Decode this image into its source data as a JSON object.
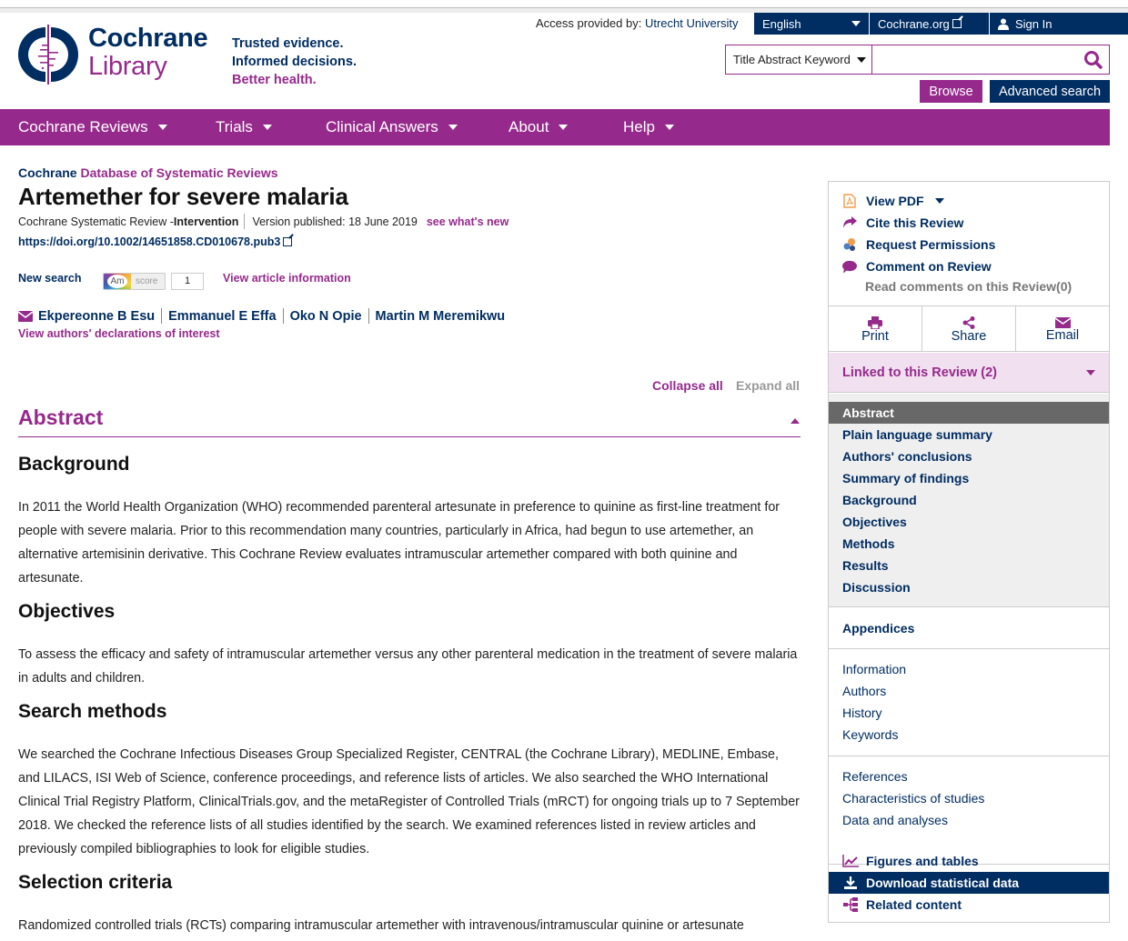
{
  "colors": {
    "brand_blue": "#002d62",
    "brand_purple": "#962a8c"
  },
  "utility": {
    "access_label": "Access provided by:",
    "access_institution": "Utrecht University",
    "language": "English",
    "cochrane_org": "Cochrane.org",
    "sign_in": "Sign In"
  },
  "logo": {
    "line1": "Cochrane",
    "line2": "Library"
  },
  "tagline": {
    "line1": "Trusted evidence.",
    "line2": "Informed decisions.",
    "line3": "Better health."
  },
  "search": {
    "scope": "Title Abstract Keyword",
    "value": "",
    "placeholder": "",
    "browse": "Browse",
    "advanced": "Advanced search"
  },
  "nav": [
    {
      "label": "Cochrane Reviews"
    },
    {
      "label": "Trials"
    },
    {
      "label": "Clinical Answers"
    },
    {
      "label": "About"
    },
    {
      "label": "Help"
    }
  ],
  "article": {
    "db_part1": "Cochrane",
    "db_part2": "Database of Systematic Reviews",
    "title": "Artemether for severe malaria",
    "review_type": "Cochrane Systematic Review - ",
    "review_kind": "Intervention",
    "version": "Version published: 18 June 2019",
    "whats_new": "see what's new",
    "doi": "https://doi.org/10.1002/14651858.CD010678.pub3",
    "new_search": "New search",
    "altmetric": {
      "am": "Am",
      "label": "score",
      "count": "1"
    },
    "view_info": "View article information",
    "authors": [
      "Ekpereonne B Esu",
      "Emmanuel E Effa",
      "Oko N Opie",
      "Martin M Meremikwu"
    ],
    "declarations": "View authors' declarations of interest",
    "collapse_all": "Collapse all",
    "expand_all": "Expand all",
    "abstract_heading": "Abstract",
    "sections": [
      {
        "heading": "Background",
        "text": "In 2011 the World Health Organization (WHO) recommended parenteral artesunate in preference to quinine as first-line treatment for people with severe malaria. Prior to this recommendation many countries, particularly in Africa, had begun to use artemether, an alternative artemisinin derivative. This Cochrane Review evaluates intramuscular artemether compared with both quinine and artesunate."
      },
      {
        "heading": "Objectives",
        "text": "To assess the efficacy and safety of intramuscular artemether versus any other parenteral medication in the treatment of severe malaria in adults and children."
      },
      {
        "heading": "Search methods",
        "text": "We searched the Cochrane Infectious Diseases Group Specialized Register, CENTRAL (the Cochrane Library), MEDLINE, Embase, and LILACS, ISI Web of Science, conference proceedings, and reference lists of articles. We also searched the WHO International Clinical Trial Registry Platform, ClinicalTrials.gov, and the metaRegister of Controlled Trials (mRCT) for ongoing trials up to 7 September 2018. We checked the reference lists of all studies identified by the search. We examined references listed in review articles and previously compiled bibliographies to look for eligible studies."
      },
      {
        "heading": "Selection criteria",
        "text": "Randomized controlled trials (RCTs) comparing intramuscular artemether with intravenous/intramuscular quinine or artesunate"
      }
    ]
  },
  "sidebar": {
    "tools": {
      "view_pdf": "View PDF",
      "cite": "Cite this Review",
      "permissions": "Request Permissions",
      "comment": "Comment on Review",
      "read_comments": "Read comments on this Review(0)"
    },
    "share": {
      "print": "Print",
      "share": "Share",
      "email": "Email"
    },
    "linked": "Linked to this Review (2)",
    "toc": [
      "Abstract",
      "Plain language summary",
      "Authors' conclusions",
      "Summary of findings",
      "Background",
      "Objectives",
      "Methods",
      "Results",
      "Discussion"
    ],
    "toc_active": "Abstract",
    "appendices": "Appendices",
    "info_links": [
      "Information",
      "Authors",
      "History",
      "Keywords"
    ],
    "ref_links": [
      "References",
      "Characteristics of studies",
      "Data and analyses"
    ],
    "extras": {
      "figures": "Figures and tables",
      "download": "Download statistical data",
      "related": "Related content"
    }
  }
}
